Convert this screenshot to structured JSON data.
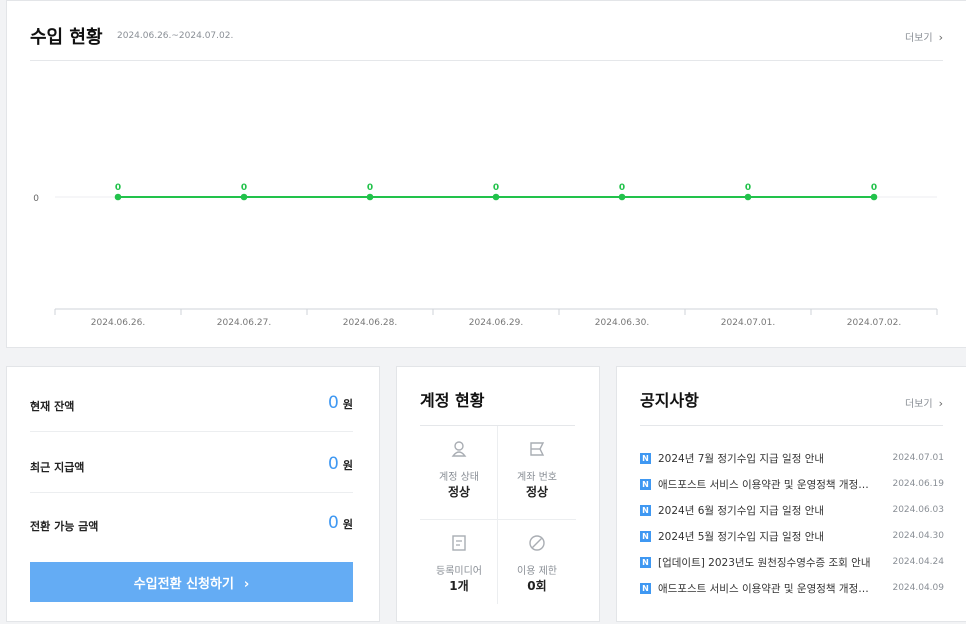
{
  "revenue": {
    "title": "수입 현황",
    "date_range": "2024.06.26.~2024.07.02.",
    "more_label": "더보기",
    "more_icon": "chevron-right-icon",
    "chart_data": {
      "type": "line",
      "categories": [
        "2024.06.26.",
        "2024.06.27.",
        "2024.06.28.",
        "2024.06.29.",
        "2024.06.30.",
        "2024.07.01.",
        "2024.07.02."
      ],
      "series": [
        {
          "values": [
            0,
            0,
            0,
            0,
            0,
            0,
            0
          ],
          "color": "#22c24b"
        }
      ],
      "y_ticks": [
        "0"
      ],
      "data_labels": true,
      "grid": false
    }
  },
  "balance": {
    "rows": [
      {
        "label": "현재 잔액",
        "value": "0",
        "unit": "원"
      },
      {
        "label": "최근 지급액",
        "value": "0",
        "unit": "원"
      },
      {
        "label": "전환 가능 금액",
        "value": "0",
        "unit": "원"
      }
    ],
    "button_label": "수입전환 신청하기",
    "button_icon": "chevron-right-icon",
    "accent": "#3f98f2",
    "button_color": "#64acf4"
  },
  "account": {
    "title": "계정 현황",
    "cells": [
      {
        "icon": "person-icon",
        "label": "계정 상태",
        "value": "정상"
      },
      {
        "icon": "card-icon",
        "label": "계좌 번호",
        "value": "정상"
      },
      {
        "icon": "document-icon",
        "label": "등록미디어",
        "value": "1개"
      },
      {
        "icon": "prohibited-icon",
        "label": "이용 제한",
        "value": "0회"
      }
    ]
  },
  "notice": {
    "title": "공지사항",
    "more_label": "더보기",
    "badge": "N",
    "items": [
      {
        "title": "2024년 7월 정기수입 지급 일정 안내",
        "date": "2024.07.01"
      },
      {
        "title": "애드포스트 서비스 이용약관 및 운영정책 개정 안내",
        "date": "2024.06.19"
      },
      {
        "title": "2024년 6월 정기수입 지급 일정 안내",
        "date": "2024.06.03"
      },
      {
        "title": "2024년 5월 정기수입 지급 일정 안내",
        "date": "2024.04.30"
      },
      {
        "title": "[업데이트] 2023년도 원천징수영수증 조회 안내",
        "date": "2024.04.24"
      },
      {
        "title": "애드포스트 서비스 이용약관 및 운영정책 개정 안내",
        "date": "2024.04.09"
      }
    ]
  }
}
